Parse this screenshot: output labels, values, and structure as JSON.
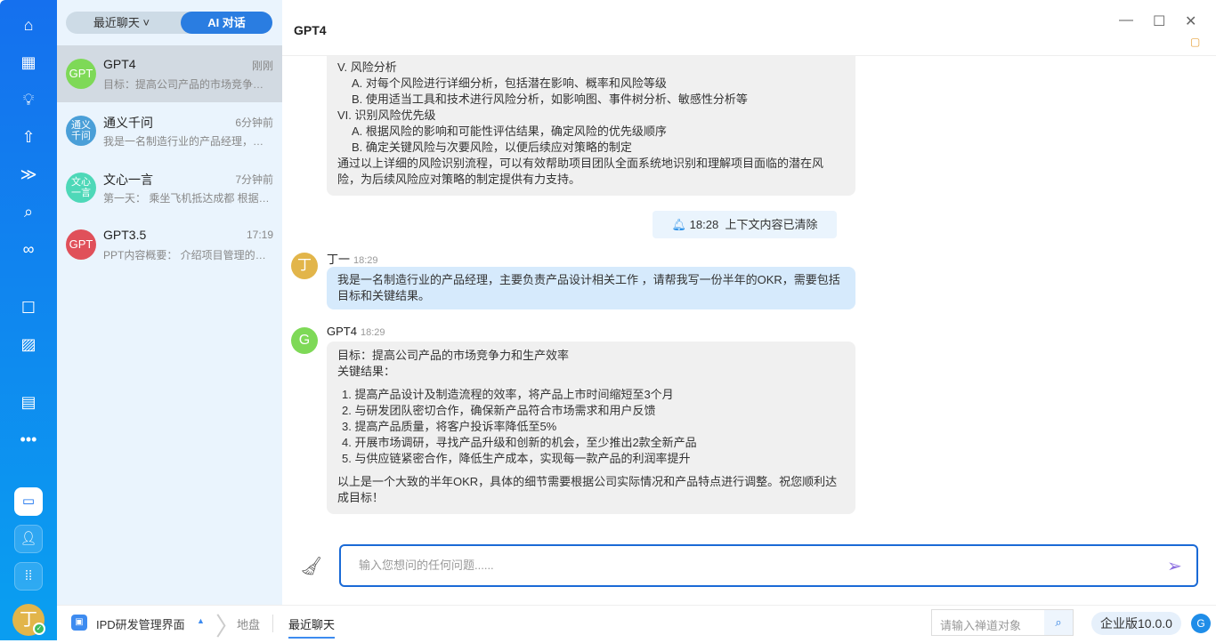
{
  "rail": {
    "icons": [
      "home-icon",
      "grid-icon",
      "bulb-icon",
      "rocket-icon",
      "run-icon",
      "search-icon",
      "infinity-icon",
      "robot-icon",
      "chart-icon",
      "inbox-icon",
      "more-icon"
    ],
    "user_initial": "丁"
  },
  "list": {
    "tab_recent": "最近聊天",
    "tab_ai": "AI 对话",
    "items": [
      {
        "name": "GPT4",
        "time": "刚刚",
        "preview": "目标：提高公司产品的市场竞争力和生产效率",
        "avatar": "GPT",
        "color": "#7ed957"
      },
      {
        "name": "通义千问",
        "time": "6分钟前",
        "preview": "我是一名制造行业的产品经理，主要负责产品设计相关工作",
        "avatar": "通义千问",
        "color": "#4a9fd8"
      },
      {
        "name": "文心一言",
        "time": "7分钟前",
        "preview": "第一天： 乘坐飞机抵达成都 根据您的行程安排",
        "avatar": "文心一言",
        "color": "#4ed8b8"
      },
      {
        "name": "GPT3.5",
        "time": "17:19",
        "preview": "PPT内容概要： 介绍项目管理的基本概念",
        "avatar": "GPT",
        "color": "#e0505a"
      }
    ]
  },
  "main": {
    "title": "GPT4",
    "prev_msg": [
      "V. 风险分析",
      "A. 对每个风险进行详细分析，包括潜在影响、概率和风险等级",
      "B. 使用适当工具和技术进行风险分析，如影响图、事件树分析、敏感性分析等",
      "VI. 识别风险优先级",
      "A. 根据风险的影响和可能性评估结果，确定风险的优先级顺序",
      "B. 确定关键风险与次要风险，以便后续应对策略的制定",
      "通过以上详细的风险识别流程，可以有效帮助项目团队全面系统地识别和理解项目面临的潜在风险，为后续风险应对策略的制定提供有力支持。"
    ],
    "notice_time": "18:28",
    "notice_text": "上下文内容已清除",
    "user_name": "丁一",
    "user_time": "18:29",
    "user_avatar": "丁",
    "user_msg": "我是一名制造行业的产品经理，主要负责产品设计相关工作 ，请帮我写一份半年的OKR，需要包括目标和关键结果。",
    "bot_name": "GPT4",
    "bot_time": "18:29",
    "bot_avatar": "G",
    "bot_goal": "目标：提高公司产品的市场竞争力和生产效率",
    "bot_kr": "关键结果：",
    "bot_list": [
      "1. 提高产品设计及制造流程的效率，将产品上市时间缩短至3个月",
      "2. 与研发团队密切合作，确保新产品符合市场需求和用户反馈",
      "3. 提高产品质量，将客户投诉率降低至5%",
      "4. 开展市场调研，寻找产品升级和创新的机会，至少推出2款全新产品",
      "5. 与供应链紧密合作，降低生产成本，实现每一款产品的利润率提升"
    ],
    "bot_end": "以上是一个大致的半年OKR，具体的细节需要根据公司实际情况和产品特点进行调整。祝您顺利达成目标！",
    "input_placeholder": "输入您想问的任何问题......"
  },
  "status": {
    "project": "IPD研发管理界面",
    "crumb1": "地盘",
    "crumb2": "最近聊天",
    "search_placeholder": "请输入禅道对象",
    "version": "企业版10.0.0"
  }
}
